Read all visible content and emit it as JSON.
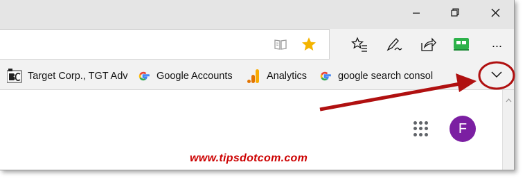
{
  "window": {
    "minimize_icon": "minimize-icon",
    "restore_icon": "restore-icon",
    "close_icon": "close-icon"
  },
  "toolbar": {
    "reading_view_icon": "book-icon",
    "favorite_star_icon": "star-icon",
    "favorite_star_color": "#f4b400",
    "favorites_hub_icon": "star-list-icon",
    "web_note_icon": "pen-icon",
    "share_icon": "share-icon",
    "extension_icon": "extension-icon",
    "extension_color": "#2db24a",
    "more_label": "···"
  },
  "favorites": {
    "items": [
      {
        "label": "Target Corp., TGT Adv",
        "icon": "bc-icon"
      },
      {
        "label": "Google Accounts",
        "icon": "google-icon"
      },
      {
        "label": "Analytics",
        "icon": "analytics-icon"
      },
      {
        "label": "google search consol",
        "icon": "google-icon"
      }
    ],
    "overflow_icon": "chevron-down-icon"
  },
  "page": {
    "avatar_letter": "F",
    "avatar_color": "#7b1fa2",
    "apps_icon": "apps-grid-icon"
  },
  "watermark": "www.tipsdotcom.com",
  "annotation": {
    "color": "#b01010"
  }
}
